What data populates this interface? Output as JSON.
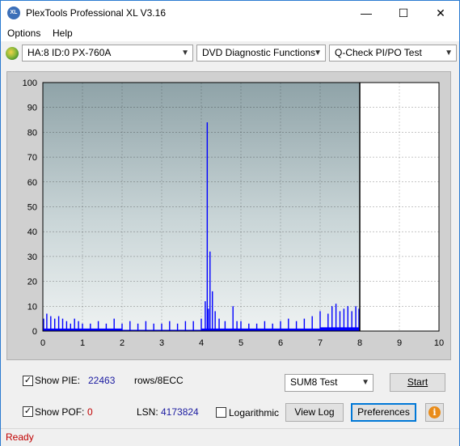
{
  "window": {
    "icon_text": "XL",
    "title": "PlexTools Professional XL V3.16",
    "minimize_glyph": "—",
    "maximize_glyph": "☐",
    "close_glyph": "✕"
  },
  "menu": {
    "options_label": "Options",
    "help_label": "Help"
  },
  "toolbar": {
    "drive_value": "HA:8 ID:0  PX-760A",
    "function_value": "DVD Diagnostic Functions",
    "test_value": "Q-Check PI/PO Test"
  },
  "chart_data": {
    "type": "bar",
    "xlim": [
      0,
      10
    ],
    "ylim": [
      0,
      100
    ],
    "x_ticks": [
      "0",
      "1",
      "2",
      "3",
      "4",
      "5",
      "6",
      "7",
      "8",
      "9",
      "10"
    ],
    "y_ticks": [
      "0",
      "10",
      "20",
      "30",
      "40",
      "50",
      "60",
      "70",
      "80",
      "90",
      "100"
    ],
    "grid": true,
    "end_marker_x": 8.0,
    "series": [
      {
        "name": "PIE",
        "color": "#0000ff",
        "x": [
          0.02,
          0.1,
          0.2,
          0.3,
          0.4,
          0.5,
          0.6,
          0.7,
          0.8,
          0.9,
          1.0,
          1.2,
          1.4,
          1.6,
          1.8,
          2.0,
          2.2,
          2.4,
          2.6,
          2.8,
          3.0,
          3.2,
          3.4,
          3.6,
          3.8,
          4.0,
          4.1,
          4.15,
          4.18,
          4.22,
          4.28,
          4.35,
          4.45,
          4.6,
          4.8,
          4.9,
          5.0,
          5.2,
          5.4,
          5.6,
          5.8,
          6.0,
          6.2,
          6.4,
          6.6,
          6.8,
          7.0,
          7.2,
          7.3,
          7.4,
          7.5,
          7.6,
          7.7,
          7.8,
          7.9,
          7.98
        ],
        "values": [
          5,
          7,
          6,
          5,
          6,
          5,
          4,
          3,
          5,
          4,
          3,
          3,
          4,
          3,
          5,
          3,
          4,
          3,
          4,
          3,
          3,
          4,
          3,
          4,
          4,
          5,
          12,
          84,
          9,
          32,
          16,
          8,
          5,
          4,
          10,
          4,
          4,
          3,
          3,
          4,
          3,
          4,
          5,
          4,
          5,
          6,
          8,
          7,
          10,
          11,
          8,
          9,
          10,
          8,
          10,
          9
        ]
      },
      {
        "name": "PIE SUM",
        "color": "#0000ff",
        "x": [
          0,
          1,
          2,
          3,
          4,
          5,
          6,
          7,
          8
        ],
        "values": [
          1,
          1,
          0.5,
          0.5,
          1,
          1,
          1,
          1.5,
          1.5
        ]
      }
    ]
  },
  "controls": {
    "show_pie_label": "Show PIE:",
    "pie_count": "22463",
    "unit": "rows/8ECC",
    "show_pof_label": "Show POF:",
    "pof_count": "0",
    "lsn_label": "LSN:",
    "lsn_value": "4173824",
    "log_label": "Logarithmic",
    "mode_value": "SUM8 Test",
    "start_label": "Start",
    "view_log_label": "View Log",
    "preferences_label": "Preferences",
    "show_pie_checked": "✓",
    "show_pof_checked": "✓",
    "info_glyph": "i"
  },
  "status": {
    "text": "Ready"
  }
}
